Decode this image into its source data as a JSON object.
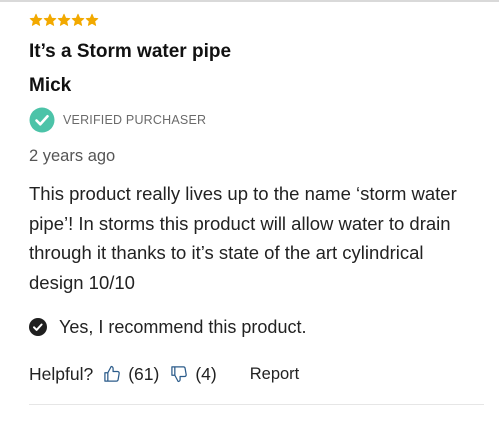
{
  "review": {
    "rating": 5,
    "rating_max": 5,
    "title": "It’s a Storm water pipe",
    "author": "Mick",
    "verified_label": "VERIFIED PURCHASER",
    "date": "2 years ago",
    "body": "This product really lives up to the name ‘storm water pipe’! In storms this product will allow water to drain through it thanks to it’s state of the art cylindrical design 10/10",
    "recommend_text": "Yes, I recommend this product.",
    "helpful_label": "Helpful?",
    "helpful_up_count": "(61)",
    "helpful_down_count": "(4)",
    "report_label": "Report"
  },
  "icons": {
    "star": "star-icon",
    "verified": "checkmark-circle-icon",
    "recommend": "checkmark-circle-icon",
    "thumbs_up": "thumbs-up-icon",
    "thumbs_down": "thumbs-down-icon"
  },
  "colors": {
    "star": "#f2a900",
    "verified_badge": "#4cc3a8",
    "recommend_badge": "#1f1f1f",
    "text_primary": "#111111",
    "text_secondary": "#6a6a6a"
  }
}
